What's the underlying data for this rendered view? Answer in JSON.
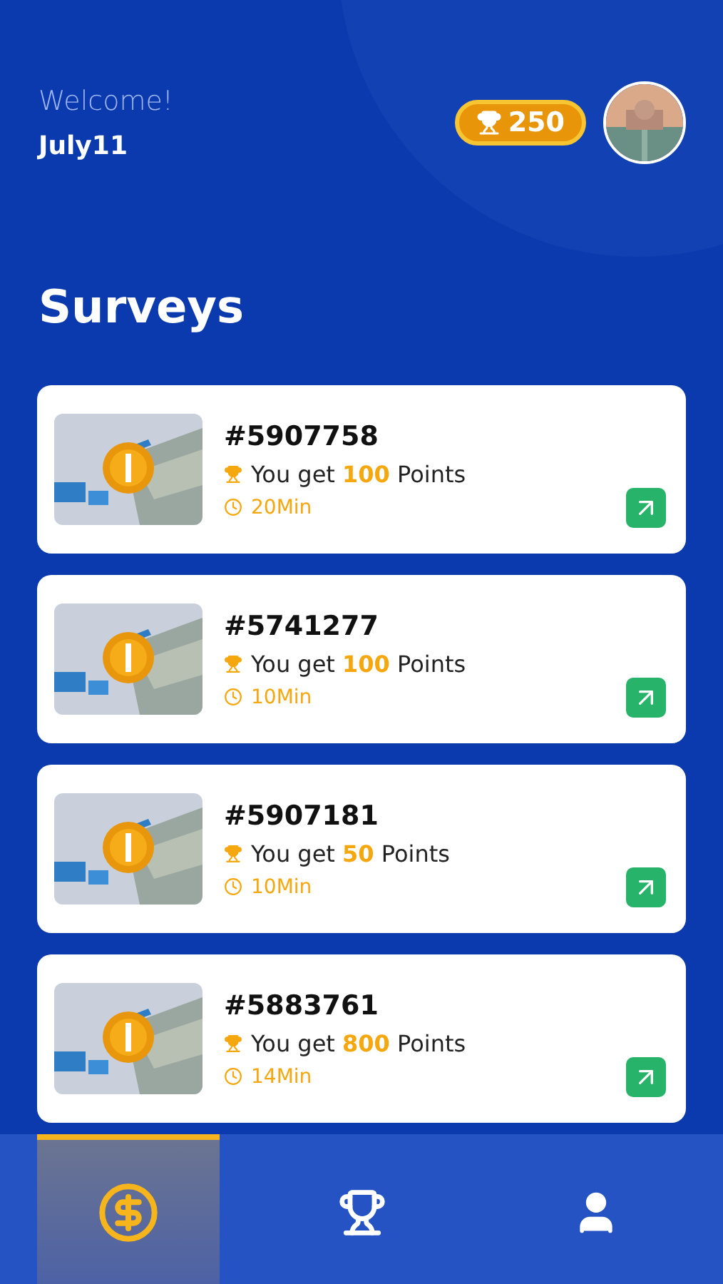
{
  "header": {
    "greeting": "Welcome!",
    "username": "July11",
    "points_badge": "250"
  },
  "title": "Surveys",
  "surveys": [
    {
      "id": "#5907758",
      "reward": "You get **100** Points",
      "duration": "20Min"
    },
    {
      "id": "#5741277",
      "reward": "You get **100** Points",
      "duration": "10Min"
    },
    {
      "id": "#5907181",
      "reward": "You get **50** Points",
      "duration": "10Min"
    },
    {
      "id": "#5883761",
      "reward": "You get **800** Points",
      "duration": "14Min"
    }
  ],
  "nav": [
    {
      "kind": "surveys",
      "selected": true
    },
    {
      "kind": "rewards",
      "selected": false
    },
    {
      "kind": "profile",
      "selected": false
    }
  ]
}
